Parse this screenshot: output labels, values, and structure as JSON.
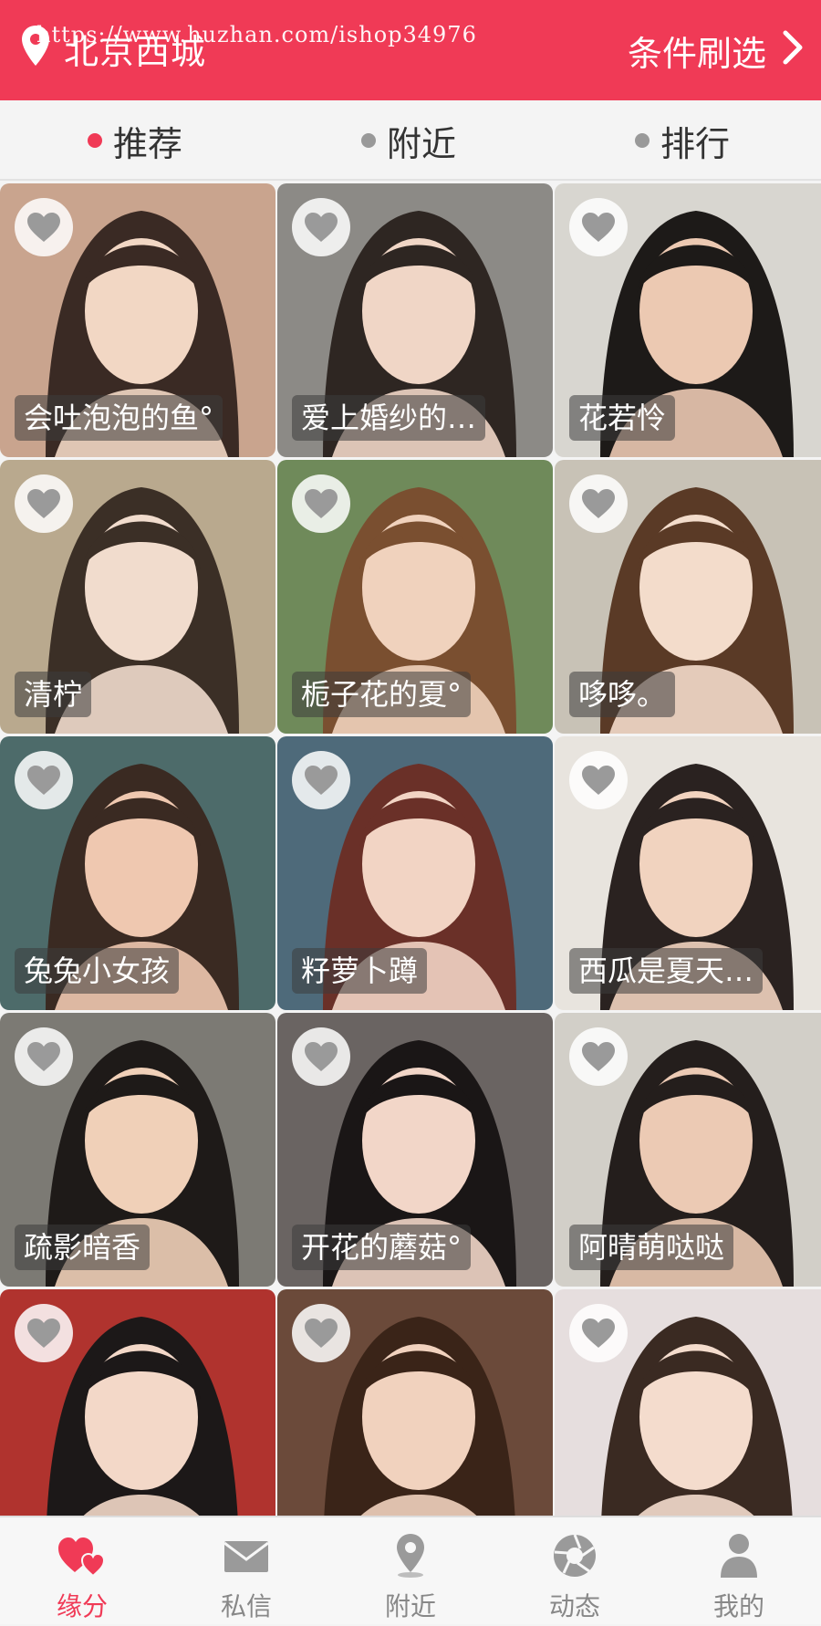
{
  "header": {
    "location": "北京西城",
    "watermark": "https://www.huzhan.com/ishop34976",
    "filter_label": "条件刷选"
  },
  "tabs": [
    {
      "label": "推荐",
      "active": true
    },
    {
      "label": "附近",
      "active": false
    },
    {
      "label": "排行",
      "active": false
    }
  ],
  "profiles": [
    {
      "name": "会吐泡泡的鱼°"
    },
    {
      "name": "爱上婚纱的…"
    },
    {
      "name": "花若怜"
    },
    {
      "name": "清柠"
    },
    {
      "name": "栀子花的夏°"
    },
    {
      "name": "哆哆。"
    },
    {
      "name": "兔兔小女孩"
    },
    {
      "name": "籽萝卜蹲"
    },
    {
      "name": "西瓜是夏天…"
    },
    {
      "name": "疏影暗香"
    },
    {
      "name": "开花的蘑菇°"
    },
    {
      "name": "阿晴萌哒哒"
    },
    {
      "name": ""
    },
    {
      "name": ""
    },
    {
      "name": ""
    }
  ],
  "bottom_nav": [
    {
      "label": "缘分",
      "icon": "hearts-icon",
      "active": true
    },
    {
      "label": "私信",
      "icon": "envelope-icon",
      "active": false
    },
    {
      "label": "附近",
      "icon": "location-pin-icon",
      "active": false
    },
    {
      "label": "动态",
      "icon": "aperture-icon",
      "active": false
    },
    {
      "label": "我的",
      "icon": "person-icon",
      "active": false
    }
  ],
  "colors": {
    "brand": "#f03a56",
    "inactive": "#888888"
  }
}
